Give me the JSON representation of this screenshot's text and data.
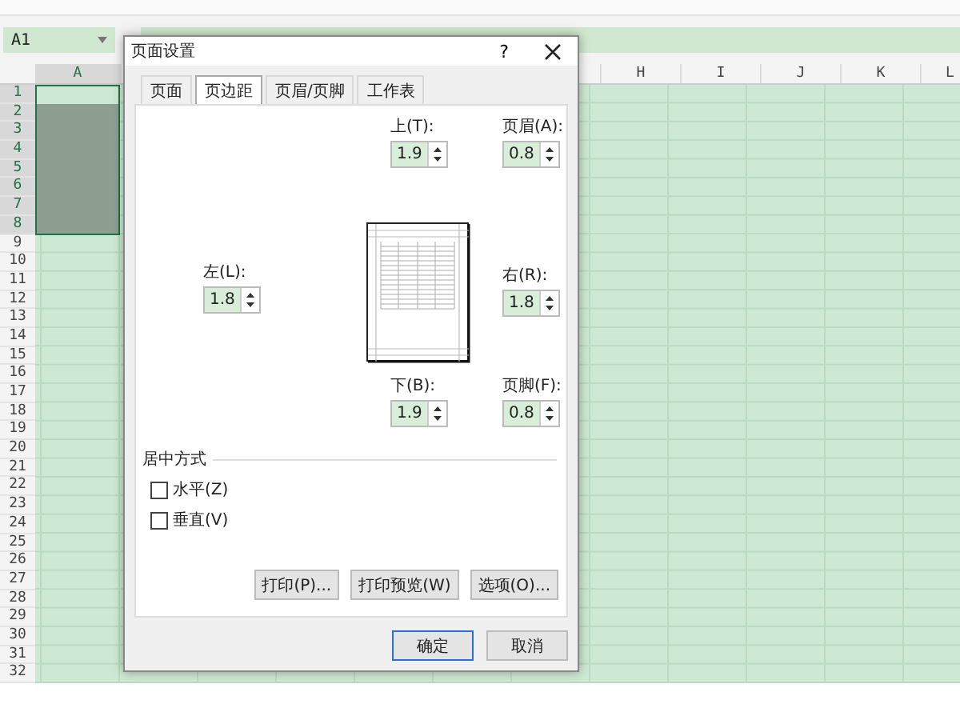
{
  "name_box": {
    "value": "A1"
  },
  "columns": [
    {
      "label": "A",
      "selected": true
    },
    {
      "label": "H",
      "selected": false
    },
    {
      "label": "I",
      "selected": false
    },
    {
      "label": "J",
      "selected": false
    },
    {
      "label": "K",
      "selected": false
    },
    {
      "label": "L",
      "selected": false
    }
  ],
  "rows": [
    {
      "label": "1",
      "selected": true
    },
    {
      "label": "2",
      "selected": true
    },
    {
      "label": "3",
      "selected": true
    },
    {
      "label": "4",
      "selected": true
    },
    {
      "label": "5",
      "selected": true
    },
    {
      "label": "6",
      "selected": true
    },
    {
      "label": "7",
      "selected": true
    },
    {
      "label": "8",
      "selected": true
    },
    {
      "label": "9",
      "selected": false
    },
    {
      "label": "10",
      "selected": false
    },
    {
      "label": "11",
      "selected": false
    },
    {
      "label": "12",
      "selected": false
    },
    {
      "label": "13",
      "selected": false
    },
    {
      "label": "14",
      "selected": false
    },
    {
      "label": "15",
      "selected": false
    },
    {
      "label": "16",
      "selected": false
    },
    {
      "label": "17",
      "selected": false
    },
    {
      "label": "18",
      "selected": false
    },
    {
      "label": "19",
      "selected": false
    },
    {
      "label": "20",
      "selected": false
    },
    {
      "label": "21",
      "selected": false
    },
    {
      "label": "22",
      "selected": false
    },
    {
      "label": "23",
      "selected": false
    },
    {
      "label": "24",
      "selected": false
    },
    {
      "label": "25",
      "selected": false
    },
    {
      "label": "26",
      "selected": false
    },
    {
      "label": "27",
      "selected": false
    },
    {
      "label": "28",
      "selected": false
    },
    {
      "label": "29",
      "selected": false
    },
    {
      "label": "30",
      "selected": false
    },
    {
      "label": "31",
      "selected": false
    },
    {
      "label": "32",
      "selected": false
    }
  ],
  "dialog": {
    "title": "页面设置",
    "help": "?",
    "tabs": [
      {
        "label": "页面",
        "selected": false
      },
      {
        "label": "页边距",
        "selected": true
      },
      {
        "label": "页眉/页脚",
        "selected": false
      },
      {
        "label": "工作表",
        "selected": false
      }
    ],
    "margins": {
      "top": {
        "label": "上(T):",
        "value": "1.9"
      },
      "header": {
        "label": "页眉(A):",
        "value": "0.8"
      },
      "left": {
        "label": "左(L):",
        "value": "1.8"
      },
      "right": {
        "label": "右(R):",
        "value": "1.8"
      },
      "bottom": {
        "label": "下(B):",
        "value": "1.9"
      },
      "footer": {
        "label": "页脚(F):",
        "value": "0.8"
      }
    },
    "centering": {
      "title": "居中方式",
      "options": [
        {
          "label": "水平(Z)",
          "checked": false
        },
        {
          "label": "垂直(V)",
          "checked": false
        }
      ]
    },
    "action_buttons": [
      "打印(P)...",
      "打印预览(W)",
      "选项(O)..."
    ],
    "ok": "确定",
    "cancel": "取消"
  }
}
